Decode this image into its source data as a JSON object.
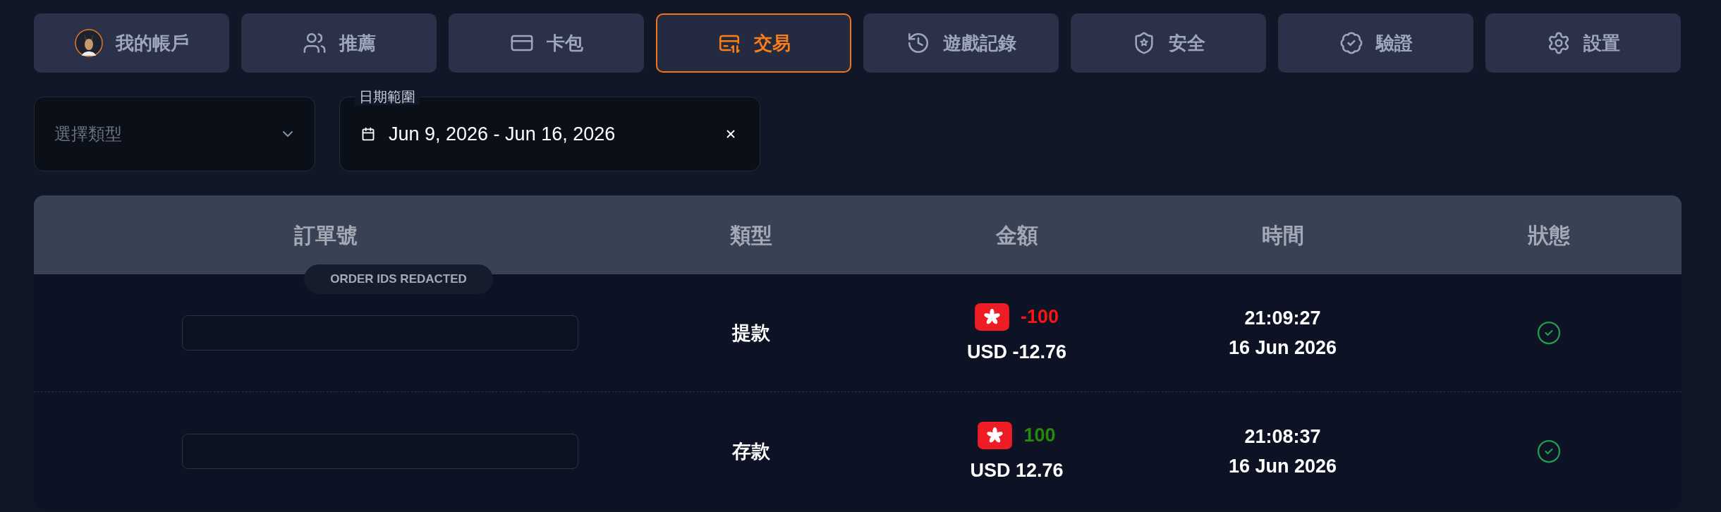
{
  "tabs": [
    {
      "label": "我的帳戶",
      "selected": false
    },
    {
      "label": "推薦",
      "selected": false
    },
    {
      "label": "卡包",
      "selected": false
    },
    {
      "label": "交易",
      "selected": true
    },
    {
      "label": "遊戲記錄",
      "selected": false
    },
    {
      "label": "安全",
      "selected": false
    },
    {
      "label": "驗證",
      "selected": false
    },
    {
      "label": "設置",
      "selected": false
    }
  ],
  "filters": {
    "type_select": {
      "placeholder": "選擇類型"
    },
    "date_range": {
      "label": "日期範圍",
      "value": "Jun 9, 2026 - Jun 16, 2026"
    }
  },
  "table": {
    "columns": [
      "訂單號",
      "類型",
      "金額",
      "時間",
      "狀態"
    ],
    "notice": "ORDER IDS REDACTED",
    "rows": [
      {
        "type": "提款",
        "amount": {
          "value": "-100",
          "color": "#fb1414"
        },
        "converted": "USD -12.76",
        "time": "21:09:27",
        "date": "16 Jun 2026",
        "completed": true
      },
      {
        "type": "存款",
        "amount": {
          "value": "100",
          "color": "#258a0a"
        },
        "converted": "USD 12.76",
        "time": "21:08:37",
        "date": "16 Jun 2026",
        "completed": true
      }
    ]
  }
}
